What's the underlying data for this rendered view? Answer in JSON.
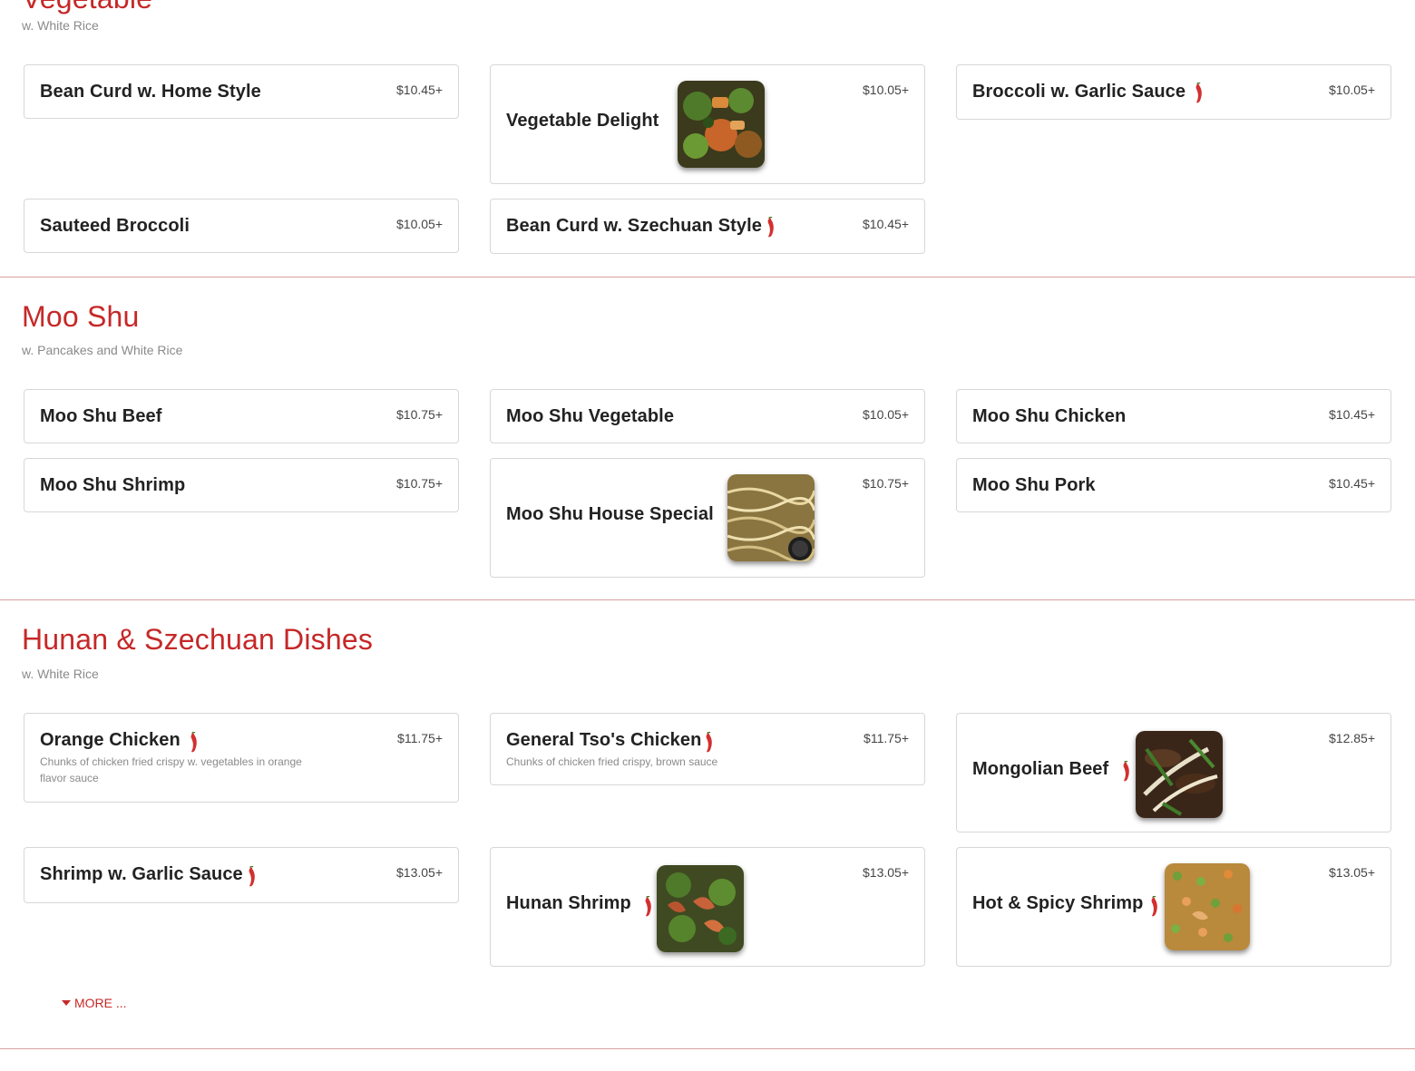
{
  "colors": {
    "accent": "#c62828",
    "text": "#222222",
    "muted": "#8a8a8a",
    "pepper": "#d32f2f"
  },
  "sections": [
    {
      "title": "Vegetable",
      "subtitle": "w. White Rice",
      "items": [
        {
          "name": "Bean Curd w. Home Style",
          "price": "$10.45+",
          "spicy": false
        },
        {
          "name": "Vegetable Delight",
          "price": "$10.05+",
          "spicy": false,
          "image": "vegetable-delight-photo"
        },
        {
          "name": "Broccoli w. Garlic Sauce",
          "price": "$10.05+",
          "spicy": true
        },
        {
          "name": "Sauteed Broccoli",
          "price": "$10.05+",
          "spicy": false
        },
        {
          "name": "Bean Curd w. Szechuan Style",
          "price": "$10.45+",
          "spicy": true
        }
      ]
    },
    {
      "title": "Moo Shu",
      "subtitle": "w. Pancakes and White Rice",
      "items": [
        {
          "name": "Moo Shu Beef",
          "price": "$10.75+",
          "spicy": false
        },
        {
          "name": "Moo Shu Vegetable",
          "price": "$10.05+",
          "spicy": false
        },
        {
          "name": "Moo Shu Chicken",
          "price": "$10.45+",
          "spicy": false
        },
        {
          "name": "Moo Shu Shrimp",
          "price": "$10.75+",
          "spicy": false
        },
        {
          "name": "Moo Shu House Special",
          "price": "$10.75+",
          "spicy": false,
          "image": "moo-shu-house-special-photo"
        },
        {
          "name": "Moo Shu Pork",
          "price": "$10.45+",
          "spicy": false
        }
      ]
    },
    {
      "title": "Hunan & Szechuan Dishes",
      "subtitle": "w. White Rice",
      "items": [
        {
          "name": "Orange Chicken",
          "price": "$11.75+",
          "spicy": true,
          "description": "Chunks of chicken fried crispy w. vegetables in orange flavor sauce"
        },
        {
          "name": "General Tso's Chicken",
          "price": "$11.75+",
          "spicy": true,
          "description": "Chunks of chicken fried crispy, brown sauce"
        },
        {
          "name": "Mongolian Beef",
          "price": "$12.85+",
          "spicy": true,
          "image": "mongolian-beef-photo"
        },
        {
          "name": "Shrimp w. Garlic Sauce",
          "price": "$13.05+",
          "spicy": true
        },
        {
          "name": "Hunan Shrimp",
          "price": "$13.05+",
          "spicy": true,
          "image": "hunan-shrimp-photo"
        },
        {
          "name": "Hot & Spicy Shrimp",
          "price": "$13.05+",
          "spicy": true,
          "image": "hot-spicy-shrimp-photo"
        }
      ],
      "more_label": "MORE ..."
    }
  ]
}
